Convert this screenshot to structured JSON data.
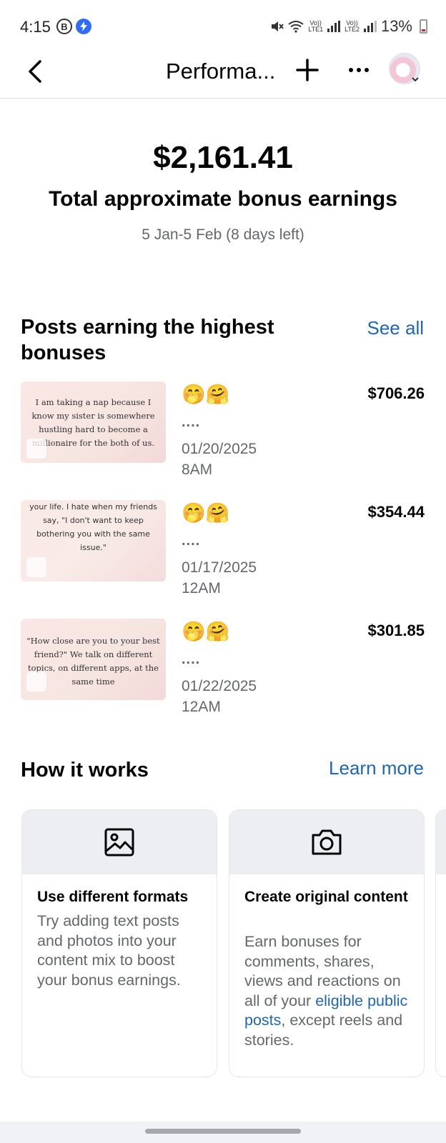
{
  "status_bar": {
    "time": "4:15",
    "b_badge": "B",
    "sim1": "Vo))\nLTE1",
    "sim2": "Vo))\nLTE2",
    "battery": "13%"
  },
  "header": {
    "title": "Performa...",
    "back_icon": "chevron-left-icon",
    "plus_icon": "plus-icon",
    "more_icon": "more-horizontal-icon"
  },
  "summary": {
    "amount": "$2,161.41",
    "label": "Total approximate bonus earnings",
    "date_range": "5 Jan-5 Feb (8 days left)"
  },
  "top_posts": {
    "title": "Posts earning the highest bonuses",
    "see_all": "See all",
    "items": [
      {
        "thumb_text": "I am taking a nap because I know my sister is somewhere hustling hard to become a millionaire for the both of us.",
        "emojis": "🤭🤗",
        "dots": "....",
        "date": "01/20/2025",
        "time": "8AM",
        "amount": "$706.26"
      },
      {
        "thumb_text": "your life. I hate when my friends say, \"I don't want to keep bothering you with the same issue.\"",
        "emojis": "🤭🤗",
        "dots": "....",
        "date": "01/17/2025",
        "time": "12AM",
        "amount": "$354.44"
      },
      {
        "thumb_text": "\"How close are you to your best friend?\" We talk on different topics, on different apps, at the same time",
        "emojis": "🤭🤗",
        "dots": "....",
        "date": "01/22/2025",
        "time": "12AM",
        "amount": "$301.85"
      }
    ]
  },
  "how_it_works": {
    "title": "How it works",
    "learn_more": "Learn more",
    "cards": [
      {
        "icon": "image-icon",
        "heading": "Use different formats",
        "body": "Try adding text posts and photos into your content mix to boost your bonus earnings."
      },
      {
        "icon": "camera-icon",
        "heading": "Create original content",
        "body_before": "Earn bonuses for comments, shares, views and reactions on all of your ",
        "body_link": "eligible public posts",
        "body_after": ", except reels and stories."
      }
    ]
  },
  "colors": {
    "link": "#1f66b7",
    "secondary_text": "#65676b",
    "card_header": "#eceef2"
  }
}
